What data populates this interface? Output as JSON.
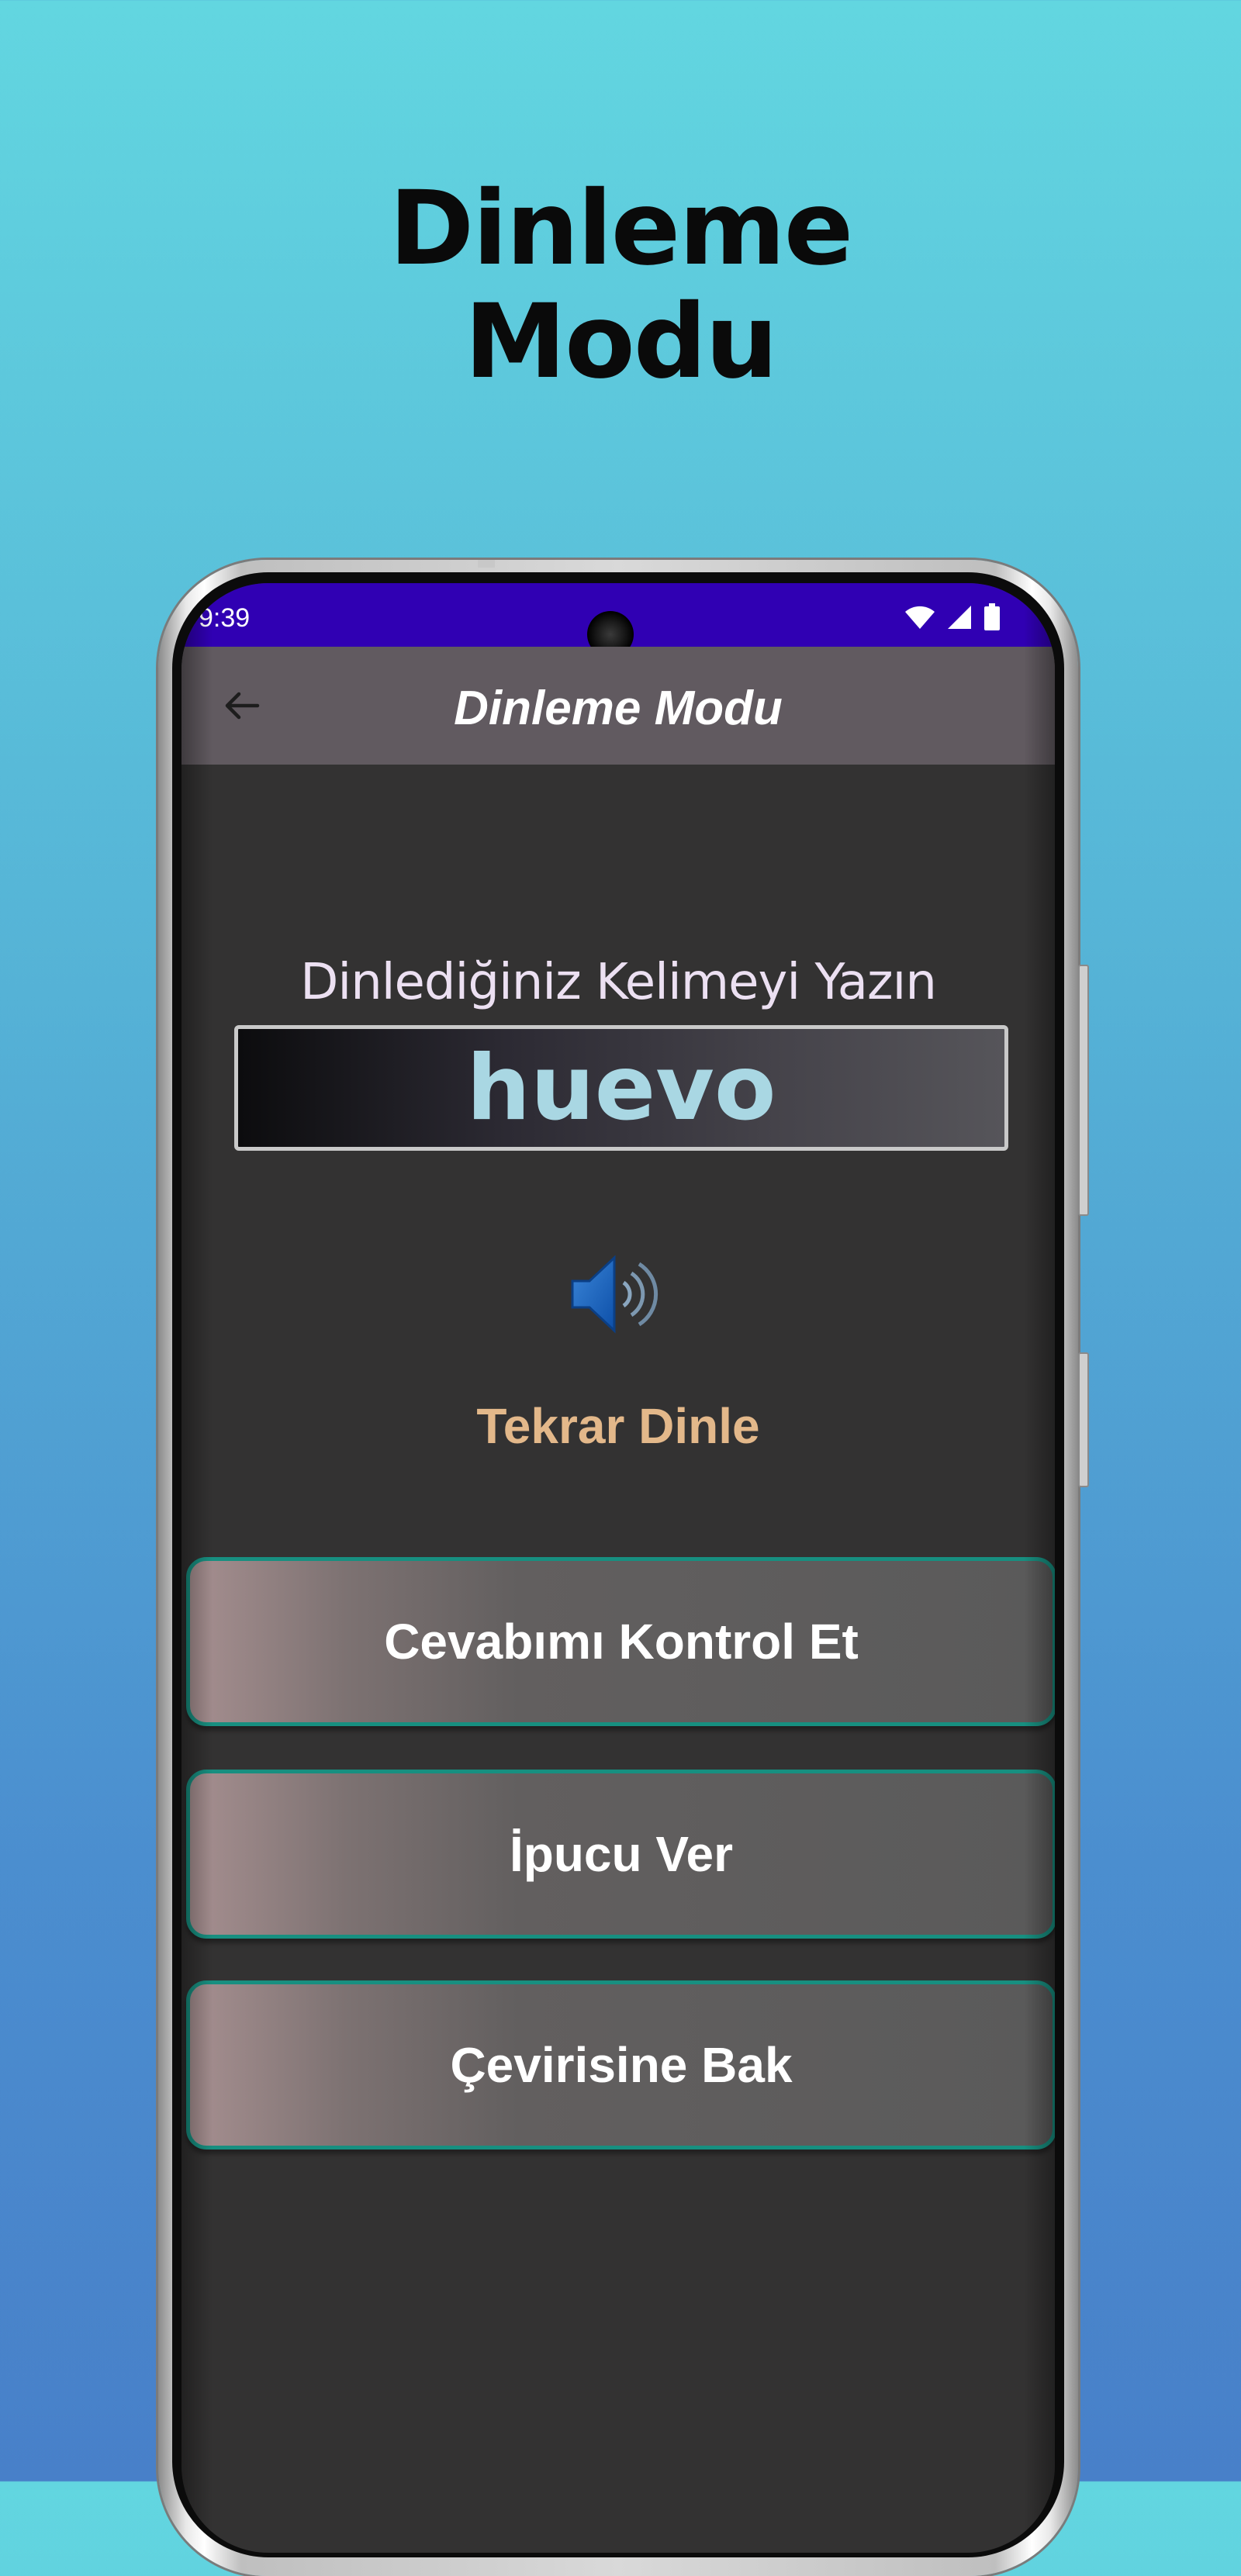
{
  "promo": {
    "title_line1": "Dinleme",
    "title_line2": "Modu"
  },
  "status_bar": {
    "time": "9:39",
    "color": "#3000b3",
    "icons": [
      "wifi-icon",
      "signal-icon",
      "battery-icon"
    ]
  },
  "app_bar": {
    "title": "Dinleme Modu",
    "back_icon": "back-arrow-icon",
    "color": "#615a60"
  },
  "main": {
    "prompt": "Dinlediğiniz Kelimeyi Yazın",
    "answer_value": "huevo",
    "speaker_icon": "speaker-icon",
    "replay_label": "Tekrar Dinle"
  },
  "buttons": {
    "check_answer": "Cevabımı Kontrol Et",
    "hint": "İpucu Ver",
    "translation": "Çevirisine Bak"
  },
  "colors": {
    "background_top": "#62d6e0",
    "background_bottom": "#4880c9",
    "screen_bg": "#333232",
    "accent_label": "#e3b88a",
    "answer_text": "#a9d7e3",
    "button_border": "#178f80"
  }
}
